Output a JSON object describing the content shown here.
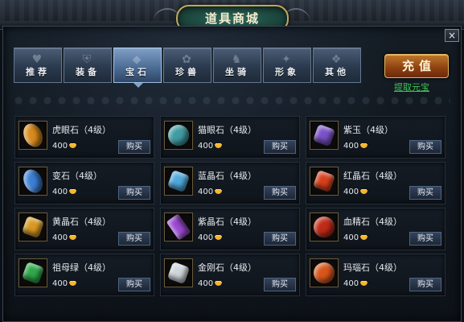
{
  "window": {
    "title": "道具商城",
    "close_label": "×"
  },
  "tabs": [
    {
      "label": "推荐",
      "icon": "heart-icon",
      "active": false
    },
    {
      "label": "装备",
      "icon": "armor-icon",
      "active": false
    },
    {
      "label": "宝石",
      "icon": "gem-icon",
      "active": true
    },
    {
      "label": "珍兽",
      "icon": "beast-icon",
      "active": false
    },
    {
      "label": "坐骑",
      "icon": "mount-icon",
      "active": false
    },
    {
      "label": "形象",
      "icon": "costume-icon",
      "active": false
    },
    {
      "label": "其他",
      "icon": "misc-icon",
      "active": false
    }
  ],
  "actions": {
    "recharge_label": "充值",
    "withdraw_label": "提取元宝"
  },
  "currency_icon": "gold-ingot-icon",
  "items": [
    {
      "name": "虎眼石（4级）",
      "price": "400",
      "buy_label": "购买",
      "color": "#d88a1c",
      "shape": "oval"
    },
    {
      "name": "猫眼石（4级）",
      "price": "400",
      "buy_label": "购买",
      "color": "#3f9ca2",
      "shape": "round"
    },
    {
      "name": "紫玉（4级）",
      "price": "400",
      "buy_label": "购买",
      "color": "#7a52c8",
      "shape": "square"
    },
    {
      "name": "变石（4级）",
      "price": "400",
      "buy_label": "购买",
      "color": "#3c7fd4",
      "shape": "oval"
    },
    {
      "name": "蓝晶石（4级）",
      "price": "400",
      "buy_label": "购买",
      "color": "#4fa9dc",
      "shape": "square"
    },
    {
      "name": "红晶石（4级）",
      "price": "400",
      "buy_label": "购买",
      "color": "#d8401c",
      "shape": "square"
    },
    {
      "name": "黄晶石（4级）",
      "price": "400",
      "buy_label": "购买",
      "color": "#d99a24",
      "shape": "square"
    },
    {
      "name": "紫晶石（4级）",
      "price": "400",
      "buy_label": "购买",
      "color": "#9b4ad0",
      "shape": "rect"
    },
    {
      "name": "血精石（4级）",
      "price": "400",
      "buy_label": "购买",
      "color": "#c02a18",
      "shape": "round"
    },
    {
      "name": "祖母绿（4级）",
      "price": "400",
      "buy_label": "购买",
      "color": "#2fa84a",
      "shape": "square"
    },
    {
      "name": "金刚石（4级）",
      "price": "400",
      "buy_label": "购买",
      "color": "#cfd6dc",
      "shape": "square"
    },
    {
      "name": "玛瑙石（4级）",
      "price": "400",
      "buy_label": "购买",
      "color": "#d8561c",
      "shape": "round"
    }
  ]
}
